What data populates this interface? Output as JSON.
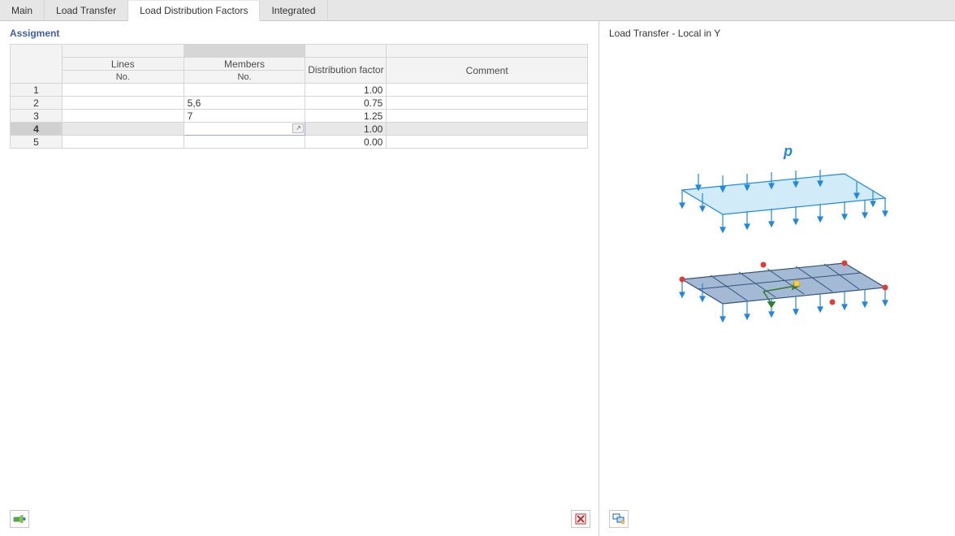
{
  "tabs": {
    "items": [
      {
        "label": "Main",
        "active": false
      },
      {
        "label": "Load Transfer",
        "active": false
      },
      {
        "label": "Load Distribution Factors",
        "active": true
      },
      {
        "label": "Integrated",
        "active": false
      }
    ]
  },
  "left": {
    "title": "Assigment",
    "headers": {
      "row": "",
      "lines": "Lines",
      "lines_sub": "No.",
      "members": "Members",
      "members_sub": "No.",
      "factor": "Distribution factor",
      "comment": "Comment"
    },
    "rows": [
      {
        "no": "1",
        "lines": "",
        "members": "",
        "factor": "1.00",
        "comment": "",
        "selected": false,
        "editing": false
      },
      {
        "no": "2",
        "lines": "",
        "members": "5,6",
        "factor": "0.75",
        "comment": "",
        "selected": false,
        "editing": false
      },
      {
        "no": "3",
        "lines": "",
        "members": "7",
        "factor": "1.25",
        "comment": "",
        "selected": false,
        "editing": false
      },
      {
        "no": "4",
        "lines": "",
        "members": "",
        "factor": "1.00",
        "comment": "",
        "selected": true,
        "editing": true
      },
      {
        "no": "5",
        "lines": "",
        "members": "",
        "factor": "0.00",
        "comment": "",
        "selected": false,
        "editing": false
      }
    ]
  },
  "right": {
    "title": "Load Transfer - Local in Y",
    "symbol": "p"
  },
  "buttons": {
    "import": "import-icon",
    "delete": "delete-icon",
    "view_options": "view-options-icon"
  }
}
